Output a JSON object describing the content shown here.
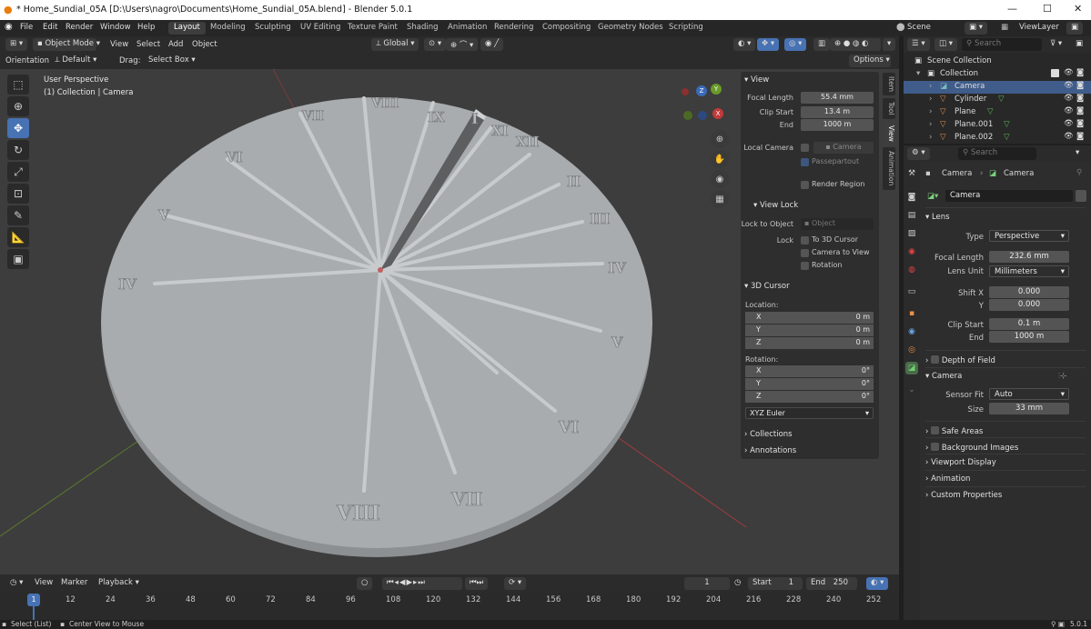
{
  "window": {
    "title": "* Home_Sundial_05A [D:\\Users\\nagro\\Documents\\Home_Sundial_05A.blend] - Blender 5.0.1"
  },
  "menu": {
    "items": [
      "File",
      "Edit",
      "Render",
      "Window",
      "Help"
    ],
    "workspaces": [
      "Layout",
      "Modeling",
      "Sculpting",
      "UV Editing",
      "Texture Paint",
      "Shading",
      "Animation",
      "Rendering",
      "Compositing",
      "Geometry Nodes",
      "Scripting"
    ],
    "scene": "Scene",
    "view_layer": "ViewLayer"
  },
  "viewport_header": {
    "mode": "Object Mode",
    "view": "View",
    "select": "Select",
    "add": "Add",
    "object": "Object",
    "transform": "Global",
    "orientation_label": "Orientation:",
    "orientation": "Default",
    "drag_label": "Drag:",
    "drag": "Select Box",
    "options": "Options"
  },
  "viewport": {
    "perspective": "User Perspective",
    "collection_info": "(1) Collection | Camera",
    "numerals": [
      "I",
      "II",
      "III",
      "IV",
      "V",
      "VI",
      "VII",
      "VIII",
      "IX",
      "X",
      "XI",
      "XII",
      "IV",
      "V",
      "VI",
      "VII",
      "VIII"
    ],
    "nav": {
      "x": "X",
      "y": "Y",
      "z": "Z"
    }
  },
  "npanel": {
    "tabs": [
      "Item",
      "Tool",
      "View",
      "Animation"
    ],
    "view": {
      "header": "View",
      "focal_length_label": "Focal Length",
      "focal_length": "55.4 mm",
      "clip_start_label": "Clip Start",
      "clip_start": "13.4 m",
      "end_label": "End",
      "end": "1000 m",
      "local_camera_label": "Local Camera",
      "local_camera": "Camera",
      "passepartout": "Passepartout",
      "render_region": "Render Region"
    },
    "view_lock": {
      "header": "View Lock",
      "lock_to_object_label": "Lock to Object",
      "lock_to_object": "Object",
      "lock_label": "Lock",
      "to_3d_cursor": "To 3D Cursor",
      "camera_to_view": "Camera to View",
      "rotation": "Rotation"
    },
    "cursor": {
      "header": "3D Cursor",
      "location_label": "Location:",
      "x_label": "X",
      "x": "0 m",
      "y_label": "Y",
      "y": "0 m",
      "z_label": "Z",
      "z": "0 m",
      "rotation_label": "Rotation:",
      "rx": "0°",
      "ry": "0°",
      "rz": "0°",
      "mode": "XYZ Euler"
    },
    "collections": "Collections",
    "annotations": "Annotations"
  },
  "timeline": {
    "view": "View",
    "marker": "Marker",
    "playback": "Playback",
    "current": "1",
    "start_label": "Start",
    "start": "1",
    "end_label": "End",
    "end": "250",
    "frames": [
      "12",
      "24",
      "36",
      "48",
      "60",
      "72",
      "84",
      "96",
      "108",
      "120",
      "132",
      "144",
      "156",
      "168",
      "180",
      "192",
      "204",
      "216",
      "228",
      "240",
      "252"
    ],
    "cursor_frame": "1"
  },
  "status": {
    "left": "Select (List)",
    "mid": "Center View to Mouse",
    "version": "5.0.1"
  },
  "outliner": {
    "search_placeholder": "Search",
    "root": "Scene Collection",
    "collection": "Collection",
    "items": [
      "Camera",
      "Cylinder",
      "Plane",
      "Plane.001",
      "Plane.002"
    ]
  },
  "props": {
    "search_placeholder": "Search",
    "breadcrumb_obj": "Camera",
    "breadcrumb_data": "Camera",
    "data_name": "Camera",
    "lens": {
      "header": "Lens",
      "type_label": "Type",
      "type": "Perspective",
      "focal_label": "Focal Length",
      "focal": "232.6 mm",
      "unit_label": "Lens Unit",
      "unit": "Millimeters",
      "shiftx_label": "Shift X",
      "shiftx": "0.000",
      "shifty_label": "Y",
      "shifty": "0.000",
      "clip_start_label": "Clip Start",
      "clip_start": "0.1 m",
      "clip_end_label": "End",
      "clip_end": "1000 m"
    },
    "dof": "Depth of Field",
    "camera": {
      "header": "Camera",
      "fit_label": "Sensor Fit",
      "fit": "Auto",
      "size_label": "Size",
      "size": "33 mm"
    },
    "collapsed": [
      "Safe Areas",
      "Background Images",
      "Viewport Display",
      "Animation",
      "Custom Properties"
    ]
  },
  "colors": {
    "accent": "#4772b3",
    "viewport_bg": "#3d3d3d",
    "dial": "#a9acae",
    "x_axis": "#c23a3a",
    "y_axis": "#6a9a2a"
  }
}
